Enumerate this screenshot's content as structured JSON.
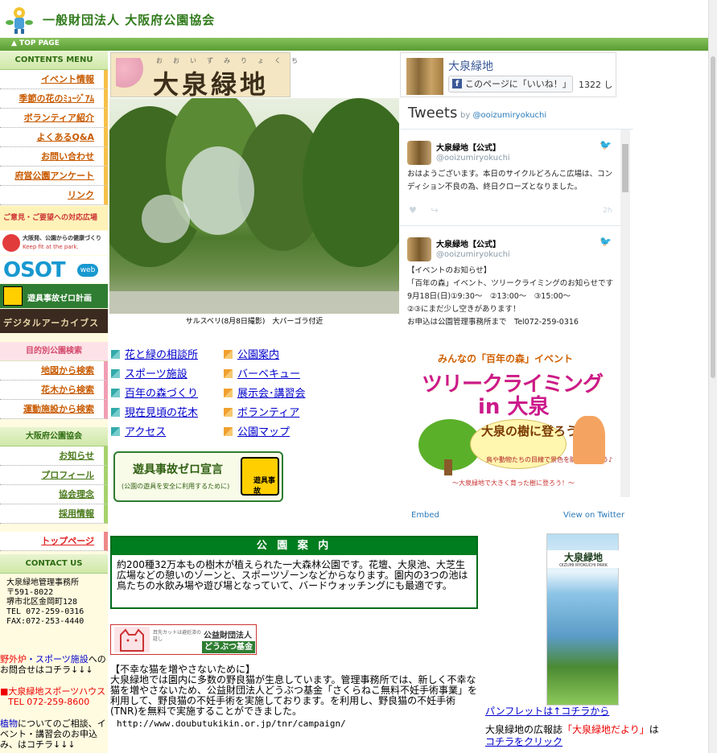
{
  "header": {
    "org_title": "一般財団法人 大阪府公園協会",
    "topbar_label": "▲ TOP PAGE"
  },
  "left_menu": {
    "contents_head": "CONTENTS MENU",
    "contents_items": [
      "イベント情報",
      "季節の花のﾐｭｰｼﾞｱﾑ",
      "ボランティア紹介",
      "よくあるQ&A",
      "お問い合わせ",
      "府営公園アンケート",
      "リンク"
    ],
    "banner_request": "ご意見・ご要望への対応広場",
    "banner_health": "大阪発、公園からの健康づくり",
    "banner_health_sub": "Keep fit at the park.",
    "banner_osot": "OSOT",
    "banner_osot_web": "web",
    "banner_zero": "遊具事故ゼロ計画",
    "banner_archive": "デジタルアーカイブス",
    "search_head": "目的別公園検索",
    "search_items": [
      "地図から検索",
      "花木から検索",
      "運動施設から検索"
    ],
    "assoc_head": "大阪府公園協会",
    "assoc_items": [
      "お知らせ",
      "プロフィール",
      "協会理念",
      "採用情報"
    ],
    "top_page": "トップページ",
    "contact_head": "CONTACT US",
    "contact_lines": [
      "大泉緑地管理事務所",
      "〒591-8022",
      "堺市北区金岡町128",
      "TEL 072-259-0316",
      "FAX:072-253-4440"
    ],
    "note1_red": "野外炉",
    "note1_blue": "・スポーツ施設",
    "note1_rest": "への",
    "note1_line2": "お問合せはコチラ↓↓↓",
    "note2_line1": "■大泉緑地スポーツハウス",
    "note2_line2": "TEL 072-259-8600",
    "note3_blue": "植物",
    "note3_rest": "についてのご相談、イ",
    "note3_line2": "ベント・講習会のお申込",
    "note3_line3": "み、はコチラ↓↓↓"
  },
  "park": {
    "ruby": "おおいずみりょくち",
    "name": "大泉緑地",
    "photo_caption": "サルスベリ(8月8日撮影)　大パーゴラ付近"
  },
  "links": {
    "left": [
      "花と緑の相談所",
      "スポーツ施設",
      "百年の森づくり",
      "現在見頃の花木",
      "アクセス"
    ],
    "right": [
      "公園案内",
      "バーベキュー",
      "展示会･講習会",
      "ボランティア",
      "公園マップ"
    ]
  },
  "zero_banner": {
    "main": "遊具事故ゼロ宣言",
    "sub": "(公園の遊具を安全に利用するために)",
    "icon_text": "遊具事故"
  },
  "guide": {
    "title": "公 園 案 内",
    "body": "約200種32万本もの樹木が植えられた一大森林公園です。花壇、大泉池、大芝生広場などの憩いのゾーンと、スポーツゾーンなどからなります。園内の3つの池は鳥たちの水飲み場や遊び場となっていて、バードウォッチングにも最適です。"
  },
  "doubutsu": {
    "line1": "公益財団法人",
    "line2": "どうぶつ基金",
    "small": "耳先カットは避妊済の証し"
  },
  "cats": {
    "heading": "【不幸な猫を増やさないために】",
    "body": "大泉緑地では園内に多数の野良猫が生息しています。管理事務所では、新しく不幸な猫を増やさないため、公益財団法人どうぶつ基金「さくらねこ無料不妊手術事業」を利用して、野良猫の不妊手術を実施しております。を利用し、野良猫の不妊手術(TNR)を無料で実施することができました。",
    "url": "http://www.doubutukikin.or.jp/tnr/campaign/"
  },
  "facebook": {
    "page_name": "大泉緑地",
    "like_label": "このページに「いいね！」",
    "like_count": "1322 し"
  },
  "twitter": {
    "title": "Tweets",
    "by_label": "by",
    "by_handle": "@ooizumiryokuchi",
    "tweets": [
      {
        "name": "大泉緑地【公式】",
        "handle": "@ooizumiryokuchi",
        "text": "おはようございます。本日のサイクルどろんこ広場は、コンディション不良の為、終日クローズとなりました。",
        "time": "2h"
      },
      {
        "name": "大泉緑地【公式】",
        "handle": "@ooizumiryokuchi",
        "text": "【イベントのお知らせ】\n「百年の森」イベント、ツリークライミングのお知らせです\n9月18日(日)①9:30～　②13:00～　③15:00～\n②③にまだ少し空きがあります！\nお申込は公園管理事務所まで　Tel072-259-0316",
        "time": ""
      }
    ],
    "event_top": "みんなの「百年の森」イベント",
    "event_title": "ツリークライミング",
    "event_title2": "in 大泉",
    "event_bubble": "大泉の樹に登ろう！",
    "event_bubble_sub": "鳥や動物たちの目線で景色を眺めてみよう♪",
    "event_foot": "～大泉緑地で大きく育った樹に登ろう！～",
    "embed_label": "Embed",
    "view_label": "View on Twitter"
  },
  "pamphlet": {
    "name": "大泉緑地",
    "sub": "OIZUMI RYOKUCHI PARK",
    "link": "パンフレットは↑コチラから",
    "koho_prefix": "大泉緑地の広報誌",
    "koho_red": "「大泉緑地だより」",
    "koho_suffix": "は",
    "koho_link": "コチラをクリック"
  }
}
